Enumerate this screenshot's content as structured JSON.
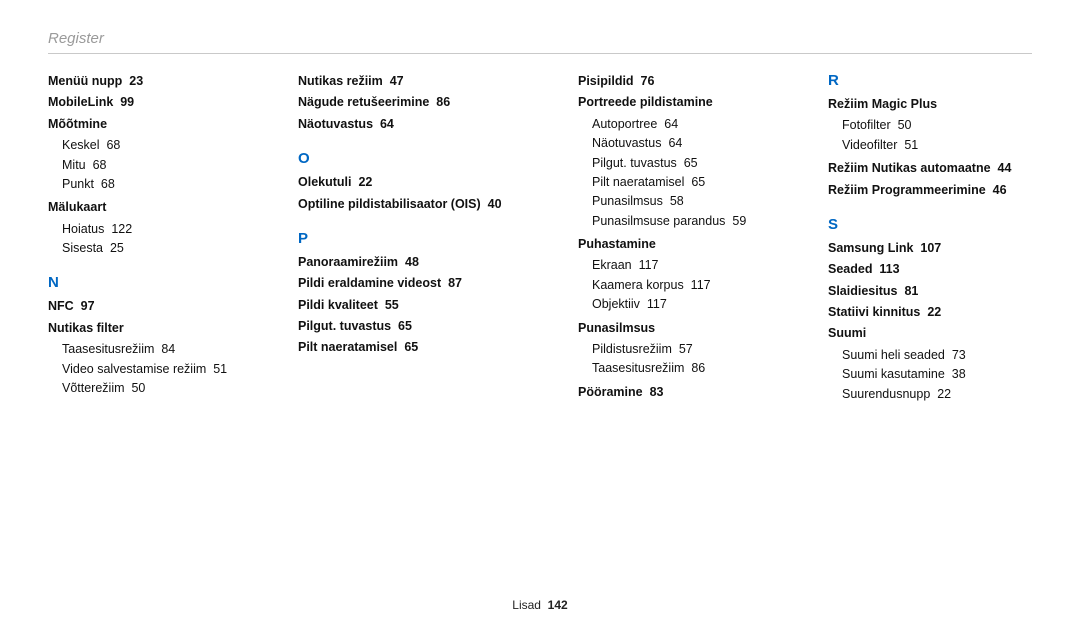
{
  "header": {
    "title": "Register"
  },
  "footer": {
    "label": "Lisad",
    "page": "142"
  },
  "col1": {
    "items": [
      {
        "type": "entry",
        "text": "Menüü nupp",
        "page": "23"
      },
      {
        "type": "entry",
        "text": "MobileLink",
        "page": "99"
      },
      {
        "type": "entry",
        "text": "Mõõtmine"
      },
      {
        "type": "sub",
        "text": "Keskel",
        "page": "68"
      },
      {
        "type": "sub",
        "text": "Mitu",
        "page": "68"
      },
      {
        "type": "sub",
        "text": "Punkt",
        "page": "68"
      },
      {
        "type": "gap"
      },
      {
        "type": "entry",
        "text": "Mälukaart"
      },
      {
        "type": "sub",
        "text": "Hoiatus",
        "page": "122"
      },
      {
        "type": "sub",
        "text": "Sisesta",
        "page": "25"
      },
      {
        "type": "letter",
        "text": "N"
      },
      {
        "type": "entry",
        "text": "NFC",
        "page": "97"
      },
      {
        "type": "entry",
        "text": "Nutikas filter"
      },
      {
        "type": "sub",
        "text": "Taasesitusrežiim",
        "page": "84"
      },
      {
        "type": "sub",
        "text": "Video salvestamise režiim",
        "page": "51"
      },
      {
        "type": "sub",
        "text": "Võtterežiim",
        "page": "50"
      }
    ]
  },
  "col2": {
    "items": [
      {
        "type": "entry",
        "text": "Nutikas režiim",
        "page": "47"
      },
      {
        "type": "entry",
        "text": "Nägude retušeerimine",
        "page": "86"
      },
      {
        "type": "entry",
        "text": "Näotuvastus",
        "page": "64"
      },
      {
        "type": "letter",
        "text": "O"
      },
      {
        "type": "entry",
        "text": "Olekutuli",
        "page": "22"
      },
      {
        "type": "entry",
        "text": "Optiline pildistabilisaator (OIS)",
        "page": "40"
      },
      {
        "type": "letter",
        "text": "P"
      },
      {
        "type": "entry",
        "text": "Panoraamirežiim",
        "page": "48"
      },
      {
        "type": "entry",
        "text": "Pildi eraldamine videost",
        "page": "87"
      },
      {
        "type": "entry",
        "text": "Pildi kvaliteet",
        "page": "55"
      },
      {
        "type": "entry",
        "text": "Pilgut. tuvastus",
        "page": "65"
      },
      {
        "type": "entry",
        "text": "Pilt naeratamisel",
        "page": "65"
      }
    ]
  },
  "col3": {
    "items": [
      {
        "type": "entry",
        "text": "Pisipildid",
        "page": "76"
      },
      {
        "type": "entry",
        "text": "Portreede pildistamine"
      },
      {
        "type": "sub",
        "text": "Autoportree",
        "page": "64"
      },
      {
        "type": "sub",
        "text": "Näotuvastus",
        "page": "64"
      },
      {
        "type": "sub",
        "text": "Pilgut. tuvastus",
        "page": "65"
      },
      {
        "type": "sub",
        "text": "Pilt naeratamisel",
        "page": "65"
      },
      {
        "type": "sub",
        "text": "Punasilmsus",
        "page": "58"
      },
      {
        "type": "sub",
        "text": "Punasilmsuse parandus",
        "page": "59"
      },
      {
        "type": "gap"
      },
      {
        "type": "entry",
        "text": "Puhastamine"
      },
      {
        "type": "sub",
        "text": "Ekraan",
        "page": "117"
      },
      {
        "type": "sub",
        "text": "Kaamera korpus",
        "page": "117"
      },
      {
        "type": "sub",
        "text": "Objektiiv",
        "page": "117"
      },
      {
        "type": "gap"
      },
      {
        "type": "entry",
        "text": "Punasilmsus"
      },
      {
        "type": "sub",
        "text": "Pildistusrežiim",
        "page": "57"
      },
      {
        "type": "sub",
        "text": "Taasesitusrežiim",
        "page": "86"
      },
      {
        "type": "gap"
      },
      {
        "type": "entry",
        "text": "Pööramine",
        "page": "83"
      }
    ]
  },
  "col4": {
    "items": [
      {
        "type": "letter",
        "text": "R",
        "first": true
      },
      {
        "type": "entry",
        "text": "Režiim Magic Plus"
      },
      {
        "type": "sub",
        "text": "Fotofilter",
        "page": "50"
      },
      {
        "type": "sub",
        "text": "Videofilter",
        "page": "51"
      },
      {
        "type": "gap"
      },
      {
        "type": "entry",
        "text": "Režiim Nutikas automaatne",
        "page": "44"
      },
      {
        "type": "entry",
        "text": "Režiim Programmeerimine",
        "page": "46"
      },
      {
        "type": "letter",
        "text": "S"
      },
      {
        "type": "entry",
        "text": "Samsung Link",
        "page": "107"
      },
      {
        "type": "entry",
        "text": "Seaded",
        "page": "113"
      },
      {
        "type": "entry",
        "text": "Slaidiesitus",
        "page": "81"
      },
      {
        "type": "entry",
        "text": "Statiivi kinnitus",
        "page": "22"
      },
      {
        "type": "entry",
        "text": "Suumi"
      },
      {
        "type": "sub",
        "text": "Suumi heli seaded",
        "page": "73"
      },
      {
        "type": "sub",
        "text": "Suumi kasutamine",
        "page": "38"
      },
      {
        "type": "sub",
        "text": "Suurendusnupp",
        "page": "22"
      }
    ]
  }
}
